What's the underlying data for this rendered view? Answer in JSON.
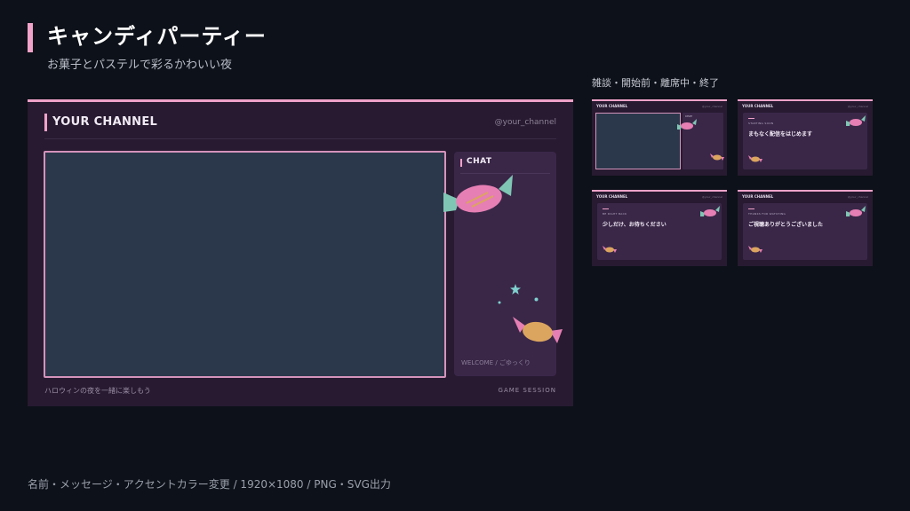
{
  "header": {
    "title": "キャンディパーティー",
    "subtitle": "お菓子とパステルで彩るかわいい夜"
  },
  "preview": {
    "channel_name": "YOUR CHANNEL",
    "handle": "@your_channel",
    "chat_title": "CHAT",
    "chat_welcome": "WELCOME / ごゆっくり",
    "footer_left": "ハロウィンの夜を一緒に楽しもう",
    "footer_right": "GAME SESSION"
  },
  "thumbnails": {
    "label": "雑談・開始前・離席中・終了",
    "items": [
      {
        "variant": "chat",
        "channel": "YOUR CHANNEL",
        "handle": "@your_channel",
        "chat_title": "CHAT"
      },
      {
        "variant": "message",
        "channel": "YOUR CHANNEL",
        "handle": "@your_channel",
        "kicker": "STARTING SOON",
        "message": "まもなく配信をはじめます"
      },
      {
        "variant": "message",
        "channel": "YOUR CHANNEL",
        "handle": "@your_channel",
        "kicker": "BE RIGHT BACK",
        "message": "少しだけ、お待ちください"
      },
      {
        "variant": "message",
        "channel": "YOUR CHANNEL",
        "handle": "@your_channel",
        "kicker": "THANKS FOR WATCHING",
        "message": "ご視聴ありがとうございました"
      }
    ]
  },
  "bottom_note": "名前・メッセージ・アクセントカラー変更 / 1920×1080 / PNG・SVG出力",
  "colors": {
    "accent": "#f0a2c9",
    "background": "#0d1119",
    "panel": "#271a31",
    "chat_panel": "#3a2748",
    "video": "#2b384b",
    "candy_pink": "#e67fb4",
    "candy_teal": "#7fc6b4",
    "candy_orange": "#dca55f",
    "star": "#7fd1cf"
  },
  "icons": [
    "candy-icon",
    "star-icon"
  ]
}
